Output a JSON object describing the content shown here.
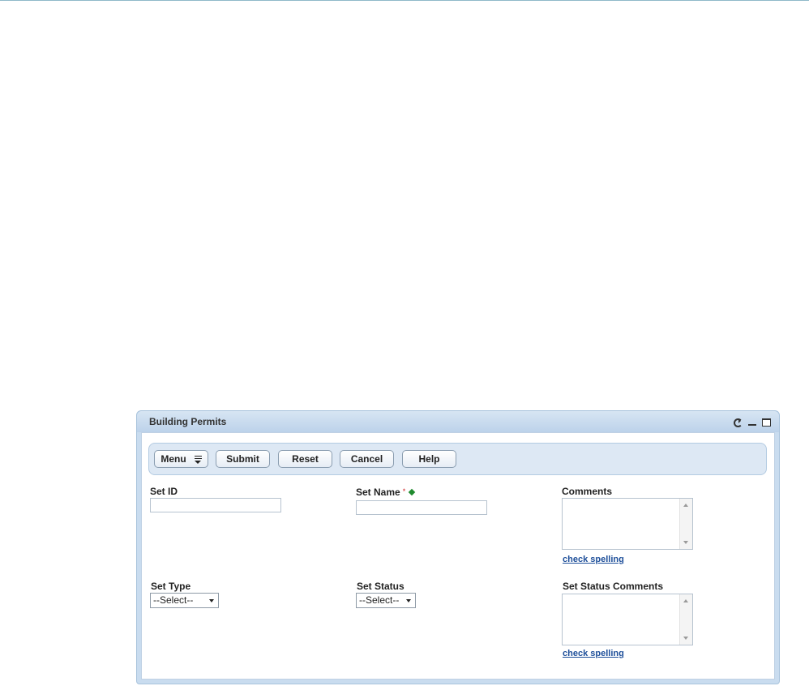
{
  "portlet": {
    "title": "Building Permits",
    "controls": [
      "refresh-icon",
      "minimize-icon",
      "maximize-icon"
    ]
  },
  "toolbar": {
    "menu_label": "Menu",
    "submit_label": "Submit",
    "reset_label": "Reset",
    "cancel_label": "Cancel",
    "help_label": "Help"
  },
  "form": {
    "set_id": {
      "label": "Set ID",
      "value": ""
    },
    "set_name": {
      "label": "Set Name",
      "required_mark": "*",
      "value": ""
    },
    "comments": {
      "label": "Comments",
      "value": "",
      "spell_link": "check spelling"
    },
    "set_type": {
      "label": "Set Type",
      "selected": "--Select--"
    },
    "set_status": {
      "label": "Set Status",
      "selected": "--Select--"
    },
    "set_status_comments": {
      "label": "Set Status Comments",
      "value": "",
      "spell_link": "check spelling"
    }
  },
  "colors": {
    "required": "#cc2222",
    "diamond": "#1f8a2e",
    "link": "#1e4f9a",
    "frame": "#c9dcef"
  }
}
